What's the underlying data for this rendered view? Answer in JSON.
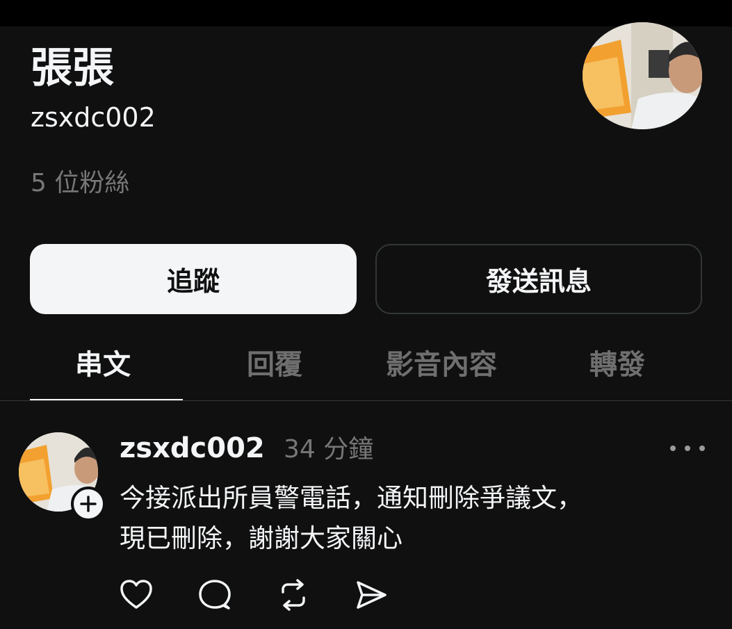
{
  "profile": {
    "display_name": "張張",
    "handle": "zsxdc002",
    "followers": "5 位粉絲"
  },
  "buttons": {
    "follow": "追蹤",
    "message": "發送訊息"
  },
  "tabs": [
    "串文",
    "回覆",
    "影音內容",
    "轉發"
  ],
  "active_tab": "串文",
  "post": {
    "author": "zsxdc002",
    "time": "34 分鐘",
    "text_line1": "今接派出所員警電話，通知刪除爭議文，",
    "text_line2": "現已刪除，謝謝大家關心"
  },
  "icons": {
    "like": "heart-icon",
    "reply": "comment-icon",
    "repost": "repost-icon",
    "share": "send-icon",
    "more": "more-icon",
    "follow_plus": "plus-icon"
  },
  "colors": {
    "background": "#101010",
    "text": "#f3f5f7",
    "muted": "#777777",
    "border": "#333638"
  }
}
